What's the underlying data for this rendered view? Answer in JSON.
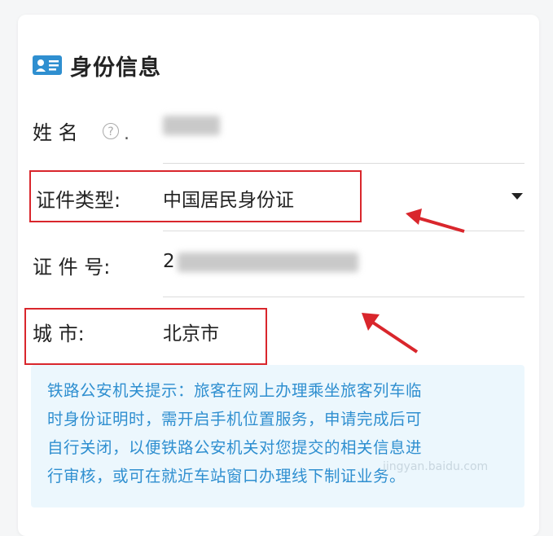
{
  "section": {
    "title": "身份信息",
    "icon": "id-card-icon"
  },
  "form": {
    "name_label": "姓   名",
    "id_type_label": "证件类型:",
    "id_type_value": "中国居民身份证",
    "id_number_label": "证 件 号:",
    "id_number_value_visible": "2",
    "city_label": "城      市:",
    "city_value": "北京市"
  },
  "notice": {
    "lines": [
      "铁路公安机关提示：旅客在网上办理乘坐旅客列车临",
      "时身份证明时，需开启手机位置服务，申请完成后可",
      "自行关闭，以便铁路公安机关对您提交的相关信息进",
      "行审核，或可在就近车站窗口办理线下制证业务。"
    ]
  },
  "watermark": {
    "text": "jingyan.baidu.com"
  },
  "colors": {
    "accent_blue": "#2f8fd0",
    "annotation_red": "#d9262c",
    "notice_bg": "#ecf7fd"
  }
}
